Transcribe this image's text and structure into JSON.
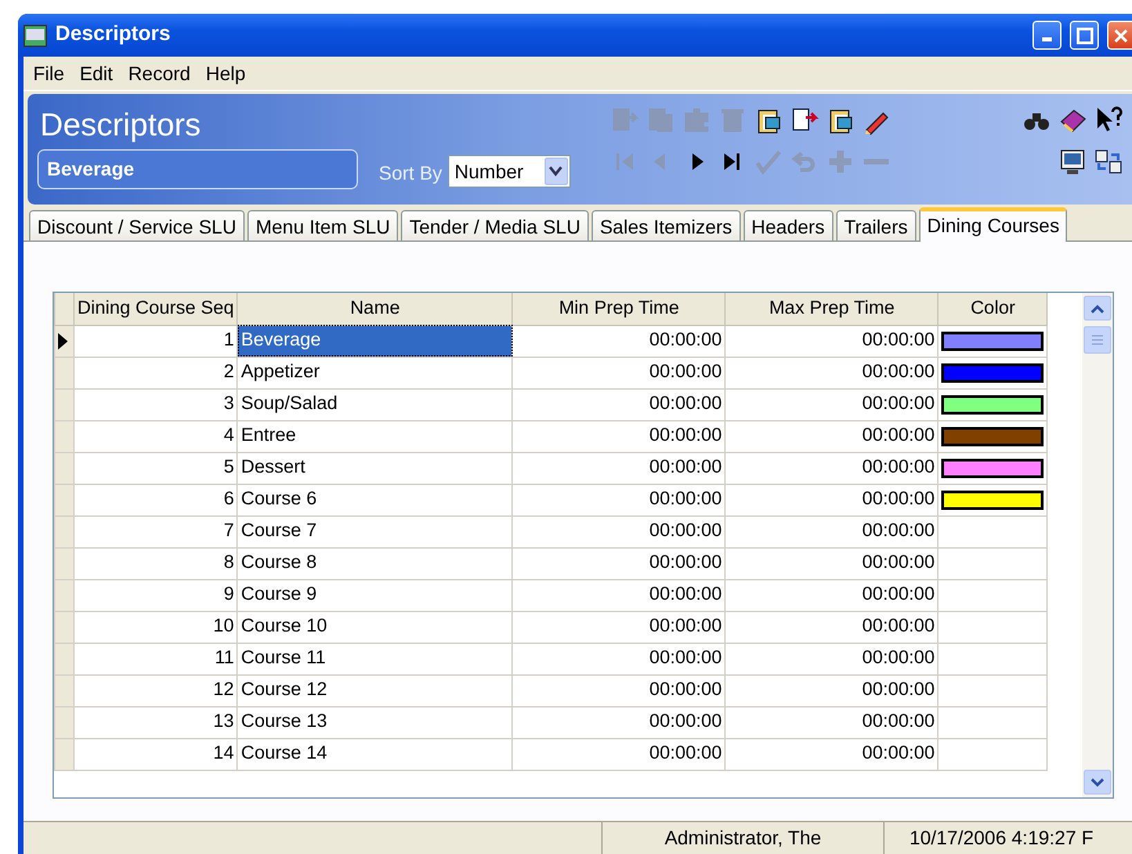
{
  "window": {
    "title": "Descriptors"
  },
  "menu": [
    "File",
    "Edit",
    "Record",
    "Help"
  ],
  "header": {
    "title": "Descriptors",
    "record": "Beverage",
    "sort_by_label": "Sort By",
    "sort_by": "Number"
  },
  "toolbar_top": [
    {
      "kind": "doc-arrow",
      "disabled": true
    },
    {
      "kind": "doc",
      "disabled": true
    },
    {
      "kind": "puzzle",
      "disabled": true
    },
    {
      "kind": "trash",
      "disabled": true
    },
    {
      "kind": "clipboard",
      "disabled": false
    },
    {
      "kind": "doc-arrow",
      "disabled": false
    },
    {
      "kind": "clipboard",
      "disabled": false
    },
    {
      "kind": "pencil",
      "disabled": false
    }
  ],
  "toolbar_right_top": [
    {
      "kind": "binoculars",
      "disabled": false
    },
    {
      "kind": "book",
      "disabled": false
    },
    {
      "kind": "help",
      "disabled": false
    }
  ],
  "toolbar_nav": [
    {
      "kind": "first",
      "disabled": true
    },
    {
      "kind": "prev",
      "disabled": true
    },
    {
      "kind": "next",
      "disabled": false
    },
    {
      "kind": "last",
      "disabled": false
    },
    {
      "kind": "check",
      "disabled": true
    },
    {
      "kind": "undo",
      "disabled": true
    },
    {
      "kind": "plus",
      "disabled": true
    },
    {
      "kind": "minus",
      "disabled": true
    }
  ],
  "toolbar_right_nav": [
    {
      "kind": "monitor",
      "disabled": false
    },
    {
      "kind": "transfer",
      "disabled": false
    }
  ],
  "tabs": [
    {
      "label": "Discount / Service SLU",
      "selected": false
    },
    {
      "label": "Menu Item SLU",
      "selected": false
    },
    {
      "label": "Tender / Media SLU",
      "selected": false
    },
    {
      "label": "Sales Itemizers",
      "selected": false
    },
    {
      "label": "Headers",
      "selected": false
    },
    {
      "label": "Trailers",
      "selected": false
    },
    {
      "label": "Dining Courses",
      "selected": true
    }
  ],
  "table": {
    "columns": [
      "Dining Course Seq",
      "Name",
      "Min Prep Time",
      "Max Prep Time",
      "Color"
    ],
    "rows": [
      {
        "seq": "1",
        "name": "Beverage",
        "min": "00:00:00",
        "max": "00:00:00",
        "color": "#8080ff",
        "selected": true
      },
      {
        "seq": "2",
        "name": "Appetizer",
        "min": "00:00:00",
        "max": "00:00:00",
        "color": "#0000ff",
        "selected": false
      },
      {
        "seq": "3",
        "name": "Soup/Salad",
        "min": "00:00:00",
        "max": "00:00:00",
        "color": "#80ff80",
        "selected": false
      },
      {
        "seq": "4",
        "name": "Entree",
        "min": "00:00:00",
        "max": "00:00:00",
        "color": "#804000",
        "selected": false
      },
      {
        "seq": "5",
        "name": "Dessert",
        "min": "00:00:00",
        "max": "00:00:00",
        "color": "#ff80ff",
        "selected": false
      },
      {
        "seq": "6",
        "name": "Course 6",
        "min": "00:00:00",
        "max": "00:00:00",
        "color": "#ffff00",
        "selected": false
      },
      {
        "seq": "7",
        "name": "Course 7",
        "min": "00:00:00",
        "max": "00:00:00",
        "selected": false
      },
      {
        "seq": "8",
        "name": "Course 8",
        "min": "00:00:00",
        "max": "00:00:00",
        "selected": false
      },
      {
        "seq": "9",
        "name": "Course 9",
        "min": "00:00:00",
        "max": "00:00:00",
        "selected": false
      },
      {
        "seq": "10",
        "name": "Course 10",
        "min": "00:00:00",
        "max": "00:00:00",
        "selected": false
      },
      {
        "seq": "11",
        "name": "Course 11",
        "min": "00:00:00",
        "max": "00:00:00",
        "selected": false
      },
      {
        "seq": "12",
        "name": "Course 12",
        "min": "00:00:00",
        "max": "00:00:00",
        "selected": false
      },
      {
        "seq": "13",
        "name": "Course 13",
        "min": "00:00:00",
        "max": "00:00:00",
        "selected": false
      },
      {
        "seq": "14",
        "name": "Course 14",
        "min": "00:00:00",
        "max": "00:00:00",
        "selected": false
      }
    ]
  },
  "status_bar": [
    "Administrator, The",
    "10/17/2006 4:19:27 F"
  ]
}
